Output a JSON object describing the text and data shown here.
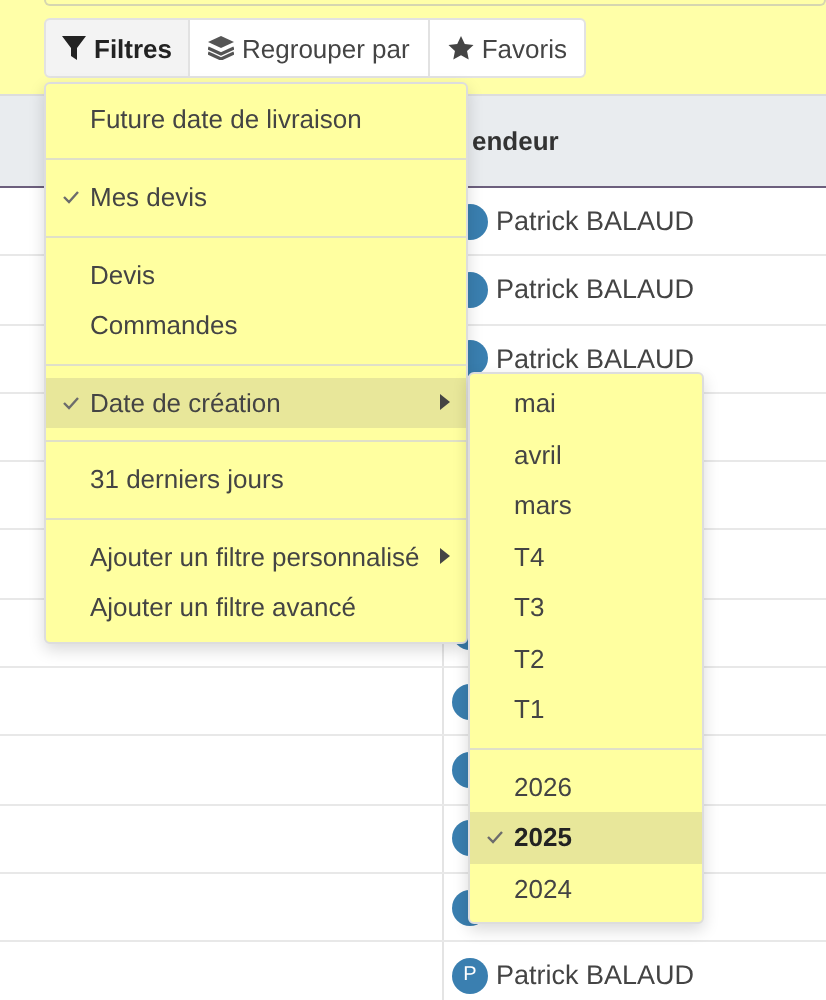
{
  "toolbar": [
    {
      "label": "Filtres",
      "selected": true
    },
    {
      "label": "Regrouper par",
      "selected": false
    },
    {
      "label": "Favoris",
      "selected": false
    }
  ],
  "table": {
    "header": "endeur",
    "rows": [
      {
        "kind": "full",
        "seller": "Patrick BALAUD"
      },
      {
        "kind": "full",
        "seller": "Patrick BALAUD"
      },
      {
        "kind": "full",
        "seller": "Patrick BALAUD"
      },
      {
        "kind": "hidden"
      },
      {
        "kind": "hidden"
      },
      {
        "kind": "hidden"
      },
      {
        "kind": "avatar"
      },
      {
        "kind": "avatar"
      },
      {
        "kind": "avatar"
      },
      {
        "kind": "avatar"
      },
      {
        "kind": "avatar"
      },
      {
        "kind": "full",
        "initial": "P",
        "seller": "Patrick BALAUD"
      }
    ]
  },
  "filter_menu": {
    "sections": [
      [
        {
          "label": "Future date de livraison",
          "checked": false,
          "expanded": false,
          "submenu": false
        }
      ],
      [
        {
          "label": "Mes devis",
          "checked": true,
          "expanded": false,
          "submenu": false
        }
      ],
      [
        {
          "label": "Devis",
          "checked": false,
          "expanded": false,
          "submenu": false
        },
        {
          "label": "Commandes",
          "checked": false,
          "expanded": false,
          "submenu": false
        }
      ],
      [
        {
          "label": "Date de création",
          "checked": true,
          "expanded": true,
          "submenu": true
        }
      ],
      [
        {
          "label": "31 derniers jours",
          "checked": false,
          "expanded": false,
          "submenu": false
        }
      ],
      [
        {
          "label": "Ajouter un filtre personnalisé",
          "checked": false,
          "expanded": false,
          "submenu": true
        },
        {
          "label": "Ajouter un filtre avancé",
          "checked": false,
          "expanded": false,
          "submenu": false
        }
      ]
    ]
  },
  "date_submenu": {
    "sections": [
      [
        {
          "label": "mai",
          "checked": false
        },
        {
          "label": "avril",
          "checked": false
        },
        {
          "label": "mars",
          "checked": false
        },
        {
          "label": "T4",
          "checked": false
        },
        {
          "label": "T3",
          "checked": false
        },
        {
          "label": "T2",
          "checked": false
        },
        {
          "label": "T1",
          "checked": false
        }
      ],
      [
        {
          "label": "2026",
          "checked": false
        },
        {
          "label": "2025",
          "checked": true
        },
        {
          "label": "2024",
          "checked": false
        }
      ]
    ]
  }
}
